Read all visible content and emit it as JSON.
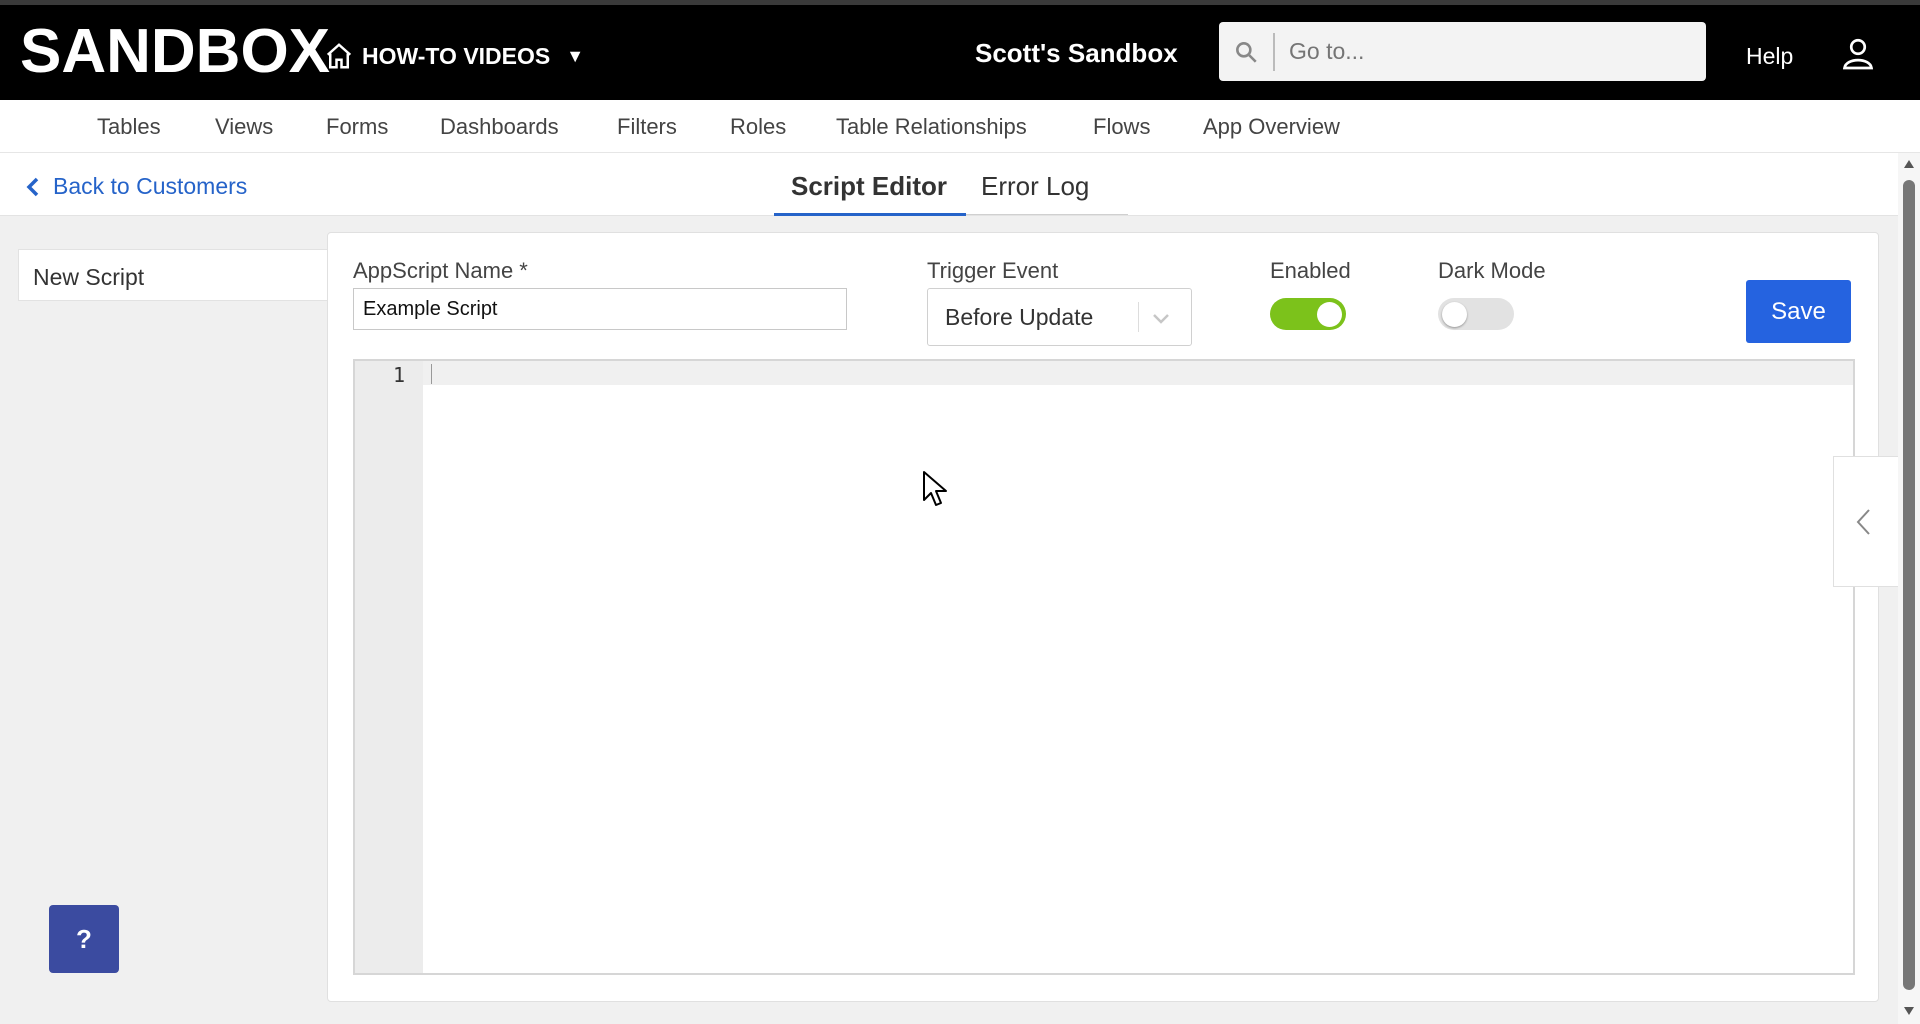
{
  "header": {
    "brand": "SANDBOX",
    "app_menu_label": "HOW-TO VIDEOS",
    "workspace_name": "Scott's Sandbox",
    "search_placeholder": "Go to...",
    "help_label": "Help"
  },
  "subnav": {
    "items": [
      "Tables",
      "Views",
      "Forms",
      "Dashboards",
      "Filters",
      "Roles",
      "Table Relationships",
      "Flows",
      "App Overview"
    ]
  },
  "tabs": {
    "back_label": "Back to Customers",
    "items": [
      "Script Editor",
      "Error Log"
    ],
    "active": "Script Editor"
  },
  "sidebar": {
    "items": [
      "New Script"
    ]
  },
  "form": {
    "name_label": "AppScript Name *",
    "name_value": "Example Script",
    "trigger_label": "Trigger Event",
    "trigger_value": "Before Update",
    "enabled_label": "Enabled",
    "enabled_on": true,
    "darkmode_label": "Dark Mode",
    "darkmode_on": false,
    "save_label": "Save"
  },
  "editor": {
    "line_numbers": [
      "1"
    ],
    "content": ""
  },
  "help_fab_label": "?",
  "colors": {
    "topbar": "#000000",
    "accent": "#2563e0",
    "link": "#2563c9",
    "toggle_on": "#7cc21b",
    "toggle_off": "#e2e2e2",
    "help_fab": "#3b4ba0"
  }
}
